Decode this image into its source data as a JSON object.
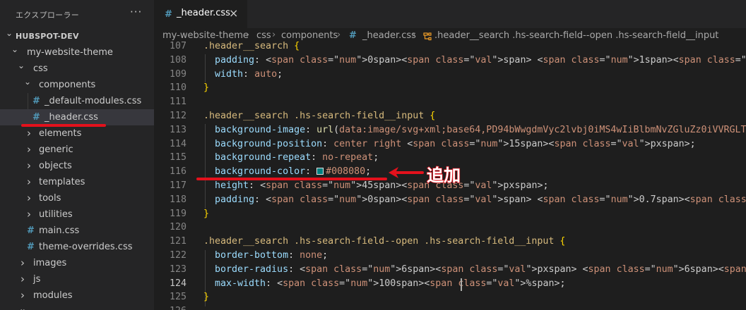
{
  "sidebar": {
    "title": "エクスプローラー",
    "more_label": "···",
    "root": "HUBSPOT-DEV",
    "tree": [
      {
        "label": "my-website-theme",
        "kind": "folder",
        "open": true
      },
      {
        "label": "css",
        "kind": "folder",
        "open": true
      },
      {
        "label": "components",
        "kind": "folder",
        "open": true
      },
      {
        "label": "_default-modules.css",
        "kind": "css-file"
      },
      {
        "label": "_header.css",
        "kind": "css-file",
        "selected": true
      },
      {
        "label": "elements",
        "kind": "folder",
        "open": false
      },
      {
        "label": "generic",
        "kind": "folder",
        "open": false
      },
      {
        "label": "objects",
        "kind": "folder",
        "open": false
      },
      {
        "label": "templates",
        "kind": "folder",
        "open": false
      },
      {
        "label": "tools",
        "kind": "folder",
        "open": false
      },
      {
        "label": "utilities",
        "kind": "folder",
        "open": false
      },
      {
        "label": "main.css",
        "kind": "css-file"
      },
      {
        "label": "theme-overrides.css",
        "kind": "css-file"
      },
      {
        "label": "images",
        "kind": "folder",
        "open": false
      },
      {
        "label": "js",
        "kind": "folder",
        "open": false
      },
      {
        "label": "modules",
        "kind": "folder",
        "open": false
      }
    ]
  },
  "tab": {
    "title": "_header.css",
    "icon": "css-hash-icon",
    "close": "×"
  },
  "breadcrumb": {
    "parts": [
      "my-website-theme",
      "css",
      "components",
      "_header.css"
    ],
    "symbol": ".header__search .hs-search-field--open .hs-search-field__input"
  },
  "editor": {
    "active_line": 124,
    "lines": [
      {
        "n": "107",
        "text": ".header__search {"
      },
      {
        "n": "108",
        "text": "padding: 0 1rem;"
      },
      {
        "n": "109",
        "text": "width: auto;"
      },
      {
        "n": "110",
        "text": "}"
      },
      {
        "n": "111",
        "text": ""
      },
      {
        "n": "112",
        "text": ".header__search .hs-search-field__input {"
      },
      {
        "n": "113",
        "text": "background-image: url(data:image/svg+xml;base64,PD94bWwgdmVyc2lvbj0iMS4wIiBlbmNvZGluZz0iVVRGLT"
      },
      {
        "n": "114",
        "text": "background-position: center right 15px;"
      },
      {
        "n": "115",
        "text": "background-repeat: no-repeat;"
      },
      {
        "n": "116",
        "text": "background-color: #008080;"
      },
      {
        "n": "117",
        "text": "height: 45px;"
      },
      {
        "n": "118",
        "text": "padding: 0 0.7rem;"
      },
      {
        "n": "119",
        "text": "}"
      },
      {
        "n": "120",
        "text": ""
      },
      {
        "n": "121",
        "text": ".header__search .hs-search-field--open .hs-search-field__input {"
      },
      {
        "n": "122",
        "text": "border-bottom: none;"
      },
      {
        "n": "123",
        "text": "border-radius: 6px 6px 0 0;"
      },
      {
        "n": "124",
        "text": "max-width: 100%;"
      },
      {
        "n": "125",
        "text": "}"
      },
      {
        "n": "126",
        "text": ""
      }
    ],
    "swatch_color": "#008080"
  },
  "annotation": {
    "label": "追加",
    "color": "#e3111c"
  }
}
